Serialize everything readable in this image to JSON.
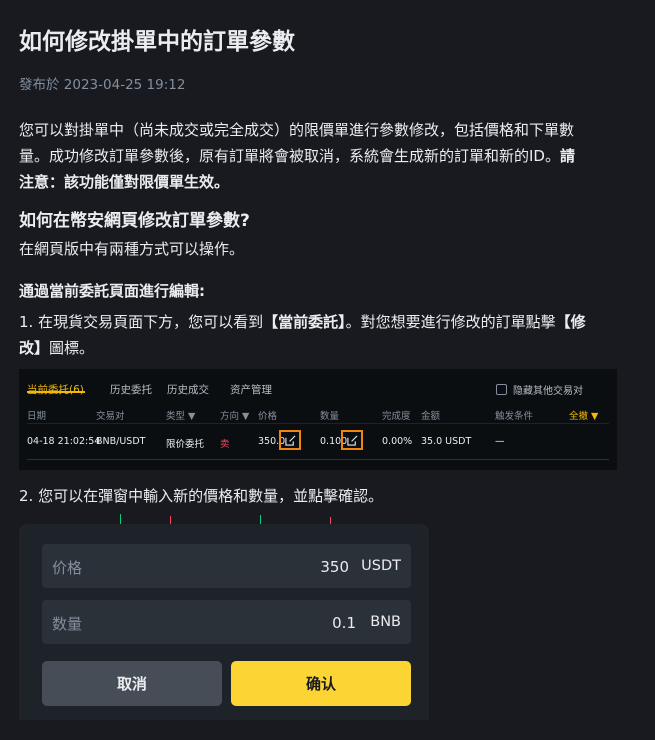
{
  "article": {
    "title": "如何修改掛單中的訂單參數",
    "date": "發布於 2023-04-25 19:12",
    "intro_line1": "您可以對掛單中（尚未成交或完全成交）的限價單進行參數修改，包括價格和下單數",
    "intro_line2": "量。成功修改訂單參數後，原有訂單將會被取消，系統會生成新的訂單和新的ID。",
    "intro_bold_a": "請",
    "intro_bold_b": "注意：該功能僅對限價單生效。",
    "heading": "如何在幣安網頁修改訂單參數?",
    "ways": "在網頁版中有兩種方式可以操作。",
    "subheading": "通過當前委託頁面進行編輯:",
    "step1_line1_a": "1. 在現貨交易頁面下方，您可以看到",
    "step1_line1_b": "【當前委託】",
    "step1_line1_c": "。對您想要進行修改的訂單點擊",
    "step1_line1_d": "【修",
    "step1_line2_a": "改】",
    "step1_line2_b": "圖標。",
    "step2": "2. 您可以在彈窗中輸入新的價格和數量，並點擊確認。"
  },
  "orders_panel": {
    "tabs": [
      "当前委托(6)",
      "历史委托",
      "历史成交",
      "资产管理"
    ],
    "hide_other": "隐藏其他交易对",
    "columns": [
      "日期",
      "交易对",
      "类型 ▼",
      "方向 ▼",
      "价格",
      "数量",
      "完成度",
      "金额",
      "触发条件",
      "全撤 ▼"
    ],
    "row": {
      "date": "04-18 21:02:54",
      "pair": "BNB/USDT",
      "type": "限价委托",
      "side": "卖",
      "price": "350.0",
      "amount": "0.100",
      "filled": "0.00%",
      "total": "35.0 USDT",
      "trigger": "—"
    }
  },
  "edit_dialog": {
    "price_label": "价格",
    "price_value": "350",
    "price_unit": "USDT",
    "qty_label": "数量",
    "qty_value": "0.1",
    "qty_unit": "BNB",
    "cancel_label": "取消",
    "confirm_label": "确认"
  },
  "colors": {
    "accent": "#f0b90b",
    "sell": "#f6465d",
    "highlight_box": "#f0860b"
  }
}
